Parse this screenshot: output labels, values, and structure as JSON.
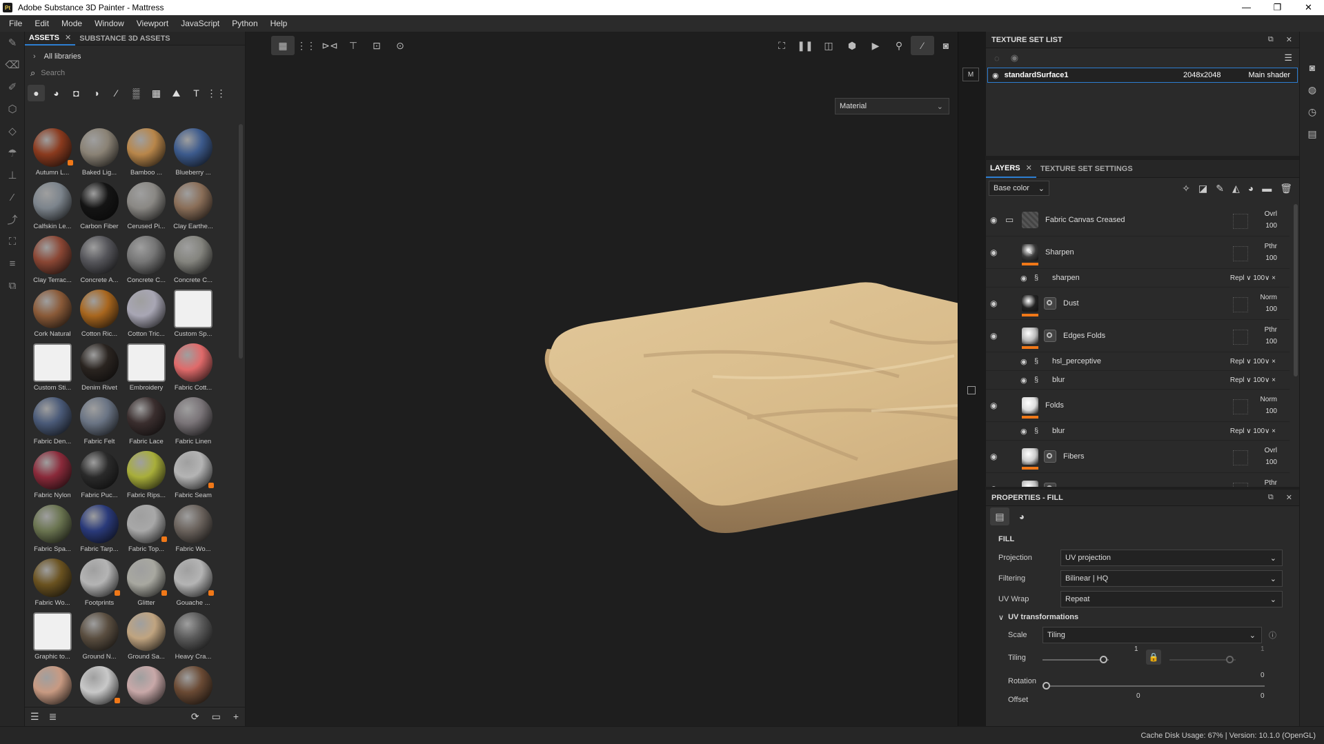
{
  "window": {
    "title": "Adobe Substance 3D Painter - Mattress",
    "app_icon": "Pt",
    "controls": [
      "—",
      "❐",
      "✕"
    ]
  },
  "menu": [
    "File",
    "Edit",
    "Mode",
    "Window",
    "Viewport",
    "JavaScript",
    "Python",
    "Help"
  ],
  "assets": {
    "tabs": [
      {
        "label": "ASSETS",
        "close": "✕"
      },
      {
        "label": "SUBSTANCE 3D ASSETS"
      }
    ],
    "library_label": "All libraries",
    "search_placeholder": "Search",
    "items": [
      {
        "label": "Autumn L...",
        "color": "#8a3a1e",
        "badge": true
      },
      {
        "label": "Baked Lig...",
        "color": "#8a8275"
      },
      {
        "label": "Bamboo ...",
        "color": "#b8864a"
      },
      {
        "label": "Blueberry ...",
        "color": "#3c5a8c"
      },
      {
        "label": "Calfskin Le...",
        "color": "#7c848c"
      },
      {
        "label": "Carbon Fiber",
        "color": "#141414"
      },
      {
        "label": "Cerused Pi...",
        "color": "#8a8884"
      },
      {
        "label": "Clay Earthe...",
        "color": "#8a6e58"
      },
      {
        "label": "Clay Terrac...",
        "color": "#8a4634"
      },
      {
        "label": "Concrete A...",
        "color": "#55555a"
      },
      {
        "label": "Concrete C...",
        "color": "#767676"
      },
      {
        "label": "Concrete C...",
        "color": "#84847e"
      },
      {
        "label": "Cork Natural",
        "color": "#8a5a38"
      },
      {
        "label": "Cotton Ric...",
        "color": "#a8661e"
      },
      {
        "label": "Cotton Tric...",
        "color": "#a8a6b4"
      },
      {
        "label": "Custom Sp...",
        "color": "#e8e8e8",
        "custom": true
      },
      {
        "label": "Custom Sti...",
        "color": "#e8e8e8",
        "custom": true
      },
      {
        "label": "Denim Rivet",
        "color": "#2a2420"
      },
      {
        "label": "Embroidery",
        "color": "#e8e8e8",
        "custom": true
      },
      {
        "label": "Fabric Cott...",
        "color": "#e06a6a"
      },
      {
        "label": "Fabric Den...",
        "color": "#4a5a78"
      },
      {
        "label": "Fabric Felt",
        "color": "#6a7484"
      },
      {
        "label": "Fabric Lace",
        "color": "#3a2e2e"
      },
      {
        "label": "Fabric Linen",
        "color": "#7a7478"
      },
      {
        "label": "Fabric Nylon",
        "color": "#8a2a3a"
      },
      {
        "label": "Fabric Puc...",
        "color": "#2a2a2a"
      },
      {
        "label": "Fabric Rips...",
        "color": "#a8ae3a"
      },
      {
        "label": "Fabric Seam",
        "color": "#b4b4b4",
        "badge": true
      },
      {
        "label": "Fabric Spa...",
        "color": "#6a7450"
      },
      {
        "label": "Fabric Tarp...",
        "color": "#2a3a7a"
      },
      {
        "label": "Fabric Top...",
        "color": "#a8a8a8",
        "badge": true
      },
      {
        "label": "Fabric Wo...",
        "color": "#6a625c"
      },
      {
        "label": "Fabric Wo...",
        "color": "#6a5220"
      },
      {
        "label": "Footprints",
        "color": "#b4b4b4",
        "badge": true
      },
      {
        "label": "Glitter",
        "color": "#a8a8a0",
        "badge": true
      },
      {
        "label": "Gouache ...",
        "color": "#b4b4b4",
        "badge": true
      },
      {
        "label": "Graphic to...",
        "color": "#e8e8e8",
        "custom": true
      },
      {
        "label": "Ground N...",
        "color": "#5a4e40"
      },
      {
        "label": "Ground Sa...",
        "color": "#c0a480"
      },
      {
        "label": "Heavy Cra...",
        "color": "#5a5a5a"
      },
      {
        "label": "",
        "color": "#c89a82"
      },
      {
        "label": "",
        "color": "#c8c8c8",
        "badge": true
      },
      {
        "label": "",
        "color": "#c8a8a8"
      },
      {
        "label": "",
        "color": "#6a4a34"
      }
    ]
  },
  "viewport": {
    "material_select": "Material",
    "mattress_color": "#d2b48a",
    "side_label": "M"
  },
  "texture_set_list": {
    "title": "TEXTURE SET LIST",
    "rows": [
      {
        "name": "standardSurface1",
        "resolution": "2048x2048",
        "shader": "Main shader"
      }
    ]
  },
  "layers": {
    "tabs": [
      {
        "label": "LAYERS",
        "close": "✕"
      },
      {
        "label": "TEXTURE SET SETTINGS"
      }
    ],
    "channel": "Base color",
    "rows": [
      {
        "type": "folder",
        "name": "Fabric Canvas Creased",
        "blend": "Ovrl",
        "opacity": "100"
      },
      {
        "type": "layer",
        "name": "Sharpen",
        "blend": "Pthr",
        "opacity": "100",
        "thumb": "#3a3a3a",
        "icon": "✎"
      },
      {
        "type": "effect",
        "name": "sharpen",
        "mode": "Repl ∨  100∨  ×"
      },
      {
        "type": "layer",
        "name": "Dust",
        "blend": "Norm",
        "opacity": "100",
        "thumb": "#222",
        "mask": true
      },
      {
        "type": "layer",
        "name": "Edges Folds",
        "blend": "Pthr",
        "opacity": "100",
        "thumb": "#bbb",
        "mask": true
      },
      {
        "type": "effect",
        "name": "hsl_perceptive",
        "mode": "Repl ∨  100∨  ×"
      },
      {
        "type": "effect",
        "name": "blur",
        "mode": "Repl ∨  100∨  ×"
      },
      {
        "type": "layer",
        "name": "Folds",
        "blend": "Norm",
        "opacity": "100",
        "thumb": "#ddd"
      },
      {
        "type": "effect",
        "name": "blur",
        "mode": "Repl ∨  100∨  ×"
      },
      {
        "type": "layer",
        "name": "Fibers",
        "blend": "Ovrl",
        "opacity": "100",
        "thumb": "#ccc",
        "mask": true
      },
      {
        "type": "layer",
        "name": "",
        "blend": "Pthr",
        "opacity": "",
        "thumb": "#bbb",
        "mask": true
      }
    ]
  },
  "properties": {
    "title": "PROPERTIES - FILL",
    "section": "FILL",
    "projection": {
      "label": "Projection",
      "value": "UV projection"
    },
    "filtering": {
      "label": "Filtering",
      "value": "Bilinear | HQ"
    },
    "uv_wrap": {
      "label": "UV Wrap",
      "value": "Repeat"
    },
    "uv_transformations": "UV transformations",
    "scale": {
      "label": "Scale",
      "value": "Tiling"
    },
    "tiling": {
      "label": "Tiling",
      "value_a": "1",
      "value_b": "1"
    },
    "rotation": {
      "label": "Rotation",
      "value": "0"
    },
    "offset": {
      "label": "Offset",
      "value_a": "0",
      "value_b": "0"
    }
  },
  "status": "Cache Disk Usage:   67% | Version: 10.1.0 (OpenGL)"
}
